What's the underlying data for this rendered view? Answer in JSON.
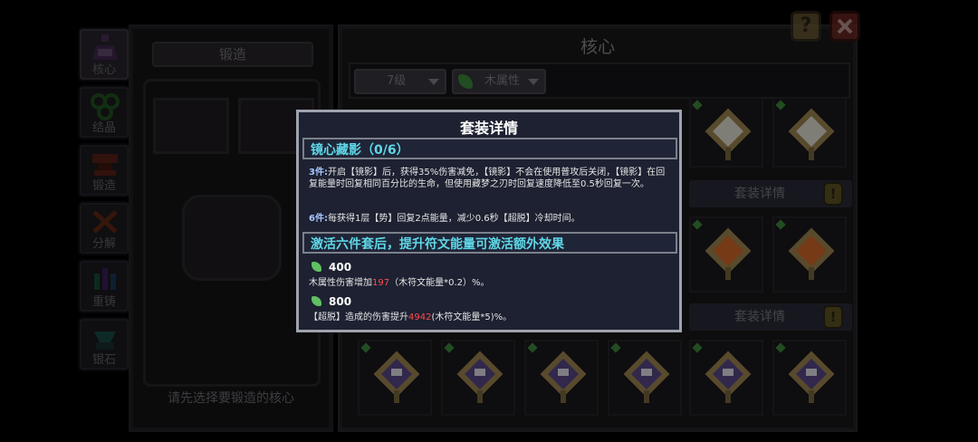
{
  "tabs": [
    {
      "label": "核心",
      "icon": "potion-icon"
    },
    {
      "label": "结晶",
      "icon": "crystal-icon"
    },
    {
      "label": "锻造",
      "icon": "anvil-icon"
    },
    {
      "label": "分解",
      "icon": "hammer-icon"
    },
    {
      "label": "重铸",
      "icon": "gem-cluster-icon"
    },
    {
      "label": "银石",
      "icon": "ore-icon"
    }
  ],
  "forge": {
    "title": "锻造",
    "hint": "请先选择要锻造的核心"
  },
  "core": {
    "title": "核心",
    "level_filter": "7级",
    "attr_filter": "木属性",
    "set_detail_label": "套装详情",
    "set_detail_label_2": "套装详情",
    "help_label": "?"
  },
  "popup": {
    "title": "套装详情",
    "set_name": "镜心藏影（0/6）",
    "three_piece_tag": "3件:",
    "three_piece_text": "开启【镜影】后，获得35%伤害减免，【镜影】不会在使用普攻后关闭，【镜影】在回复能量时回复相同百分比的生命，但使用藏梦之刃时回复速度降低至0.5秒回复一次。",
    "six_piece_tag": "6件:",
    "six_piece_text": "每获得1层【势】回复2点能量，减少0.6秒【超脱】冷却时间。",
    "bonus_header": "激活六件套后，提升符文能量可激活额外效果",
    "tier1_value": "400",
    "tier1_text_a": "木属性伤害增加",
    "tier1_red": "197",
    "tier1_text_b": "（木符文能量*0.2）%。",
    "tier2_value": "800",
    "tier2_text_a": "【超脱】造成的伤害提升",
    "tier2_red": "4942",
    "tier2_text_b": "(木符文能量*5)%。"
  },
  "colors": {
    "popup_bg": "#1d2131",
    "section_text": "#5fd8e8",
    "highlight_red": "#ff4b4b",
    "leaf_green": "#5fbf63"
  }
}
